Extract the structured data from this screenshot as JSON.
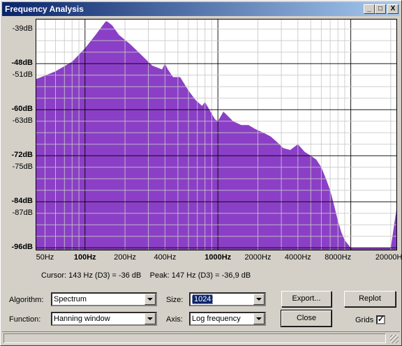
{
  "window": {
    "title": "Frequency Analysis"
  },
  "controls": {
    "minimize": "_",
    "maximize": "□",
    "close": "X"
  },
  "status": {
    "cursor": "Cursor: 143 Hz (D3) = -36 dB",
    "peak": "Peak: 147 Hz (D3) = -36,9 dB"
  },
  "algorithm": {
    "label": "Algorithm:",
    "value": "Spectrum"
  },
  "function": {
    "label": "Function:",
    "value": "Hanning window"
  },
  "size": {
    "label": "Size:",
    "value": "1024"
  },
  "axis": {
    "label": "Axis:",
    "value": "Log frequency"
  },
  "buttons": {
    "export": "Export...",
    "replot": "Replot",
    "close": "Close"
  },
  "grids": {
    "label": "Grids",
    "checked": true
  },
  "chart_data": {
    "type": "area",
    "color": "#8b3fc6",
    "grid": true,
    "xscale": "log",
    "xlim": [
      43,
      22050
    ],
    "ylim": [
      -96.5,
      -36.5
    ],
    "y_ticks": [
      {
        "v": -39,
        "label": "-39dB",
        "bold": false
      },
      {
        "v": -48,
        "label": "-48dB",
        "bold": true
      },
      {
        "v": -51,
        "label": "-51dB",
        "bold": false
      },
      {
        "v": -60,
        "label": "-60dB",
        "bold": true
      },
      {
        "v": -63,
        "label": "-63dB",
        "bold": false
      },
      {
        "v": -72,
        "label": "-72dB",
        "bold": true
      },
      {
        "v": -75,
        "label": "-75dB",
        "bold": false
      },
      {
        "v": -84,
        "label": "-84dB",
        "bold": true
      },
      {
        "v": -87,
        "label": "-87dB",
        "bold": false
      },
      {
        "v": -96,
        "label": "-96dB",
        "bold": true
      }
    ],
    "x_ticks": [
      {
        "v": 50,
        "label": "50Hz",
        "bold": false
      },
      {
        "v": 100,
        "label": "100Hz",
        "bold": true
      },
      {
        "v": 200,
        "label": "200Hz",
        "bold": false
      },
      {
        "v": 400,
        "label": "400Hz",
        "bold": false
      },
      {
        "v": 1000,
        "label": "1000Hz",
        "bold": true
      },
      {
        "v": 2000,
        "label": "2000Hz",
        "bold": false
      },
      {
        "v": 4000,
        "label": "4000Hz",
        "bold": false
      },
      {
        "v": 8000,
        "label": "8000Hz",
        "bold": false
      },
      {
        "v": 20000,
        "label": "20000Hz",
        "bold": false
      }
    ],
    "x": [
      43,
      60,
      80,
      100,
      120,
      143,
      147,
      160,
      180,
      220,
      280,
      320,
      380,
      400,
      420,
      460,
      520,
      600,
      680,
      760,
      800,
      880,
      950,
      1000,
      1100,
      1300,
      1500,
      1700,
      1900,
      2200,
      2500,
      2800,
      3100,
      3500,
      4000,
      4500,
      5000,
      5500,
      6000,
      6500,
      7000,
      7500,
      8000,
      8500,
      9000,
      10000,
      12000,
      15000,
      20000,
      22050
    ],
    "y": [
      -52,
      -50,
      -47.5,
      -44,
      -40.5,
      -37,
      -37,
      -38,
      -40.5,
      -43,
      -46.5,
      -48.5,
      -49.5,
      -48,
      -49.5,
      -51.5,
      -51.5,
      -55,
      -57.5,
      -59,
      -58,
      -60.5,
      -62.5,
      -63,
      -60.5,
      -63,
      -64,
      -64,
      -65,
      -66,
      -67,
      -68.5,
      -70,
      -70.5,
      -69,
      -71,
      -72,
      -73,
      -75,
      -78,
      -81,
      -85,
      -89,
      -92,
      -94,
      -96,
      -96,
      -96,
      -96,
      -86
    ]
  }
}
